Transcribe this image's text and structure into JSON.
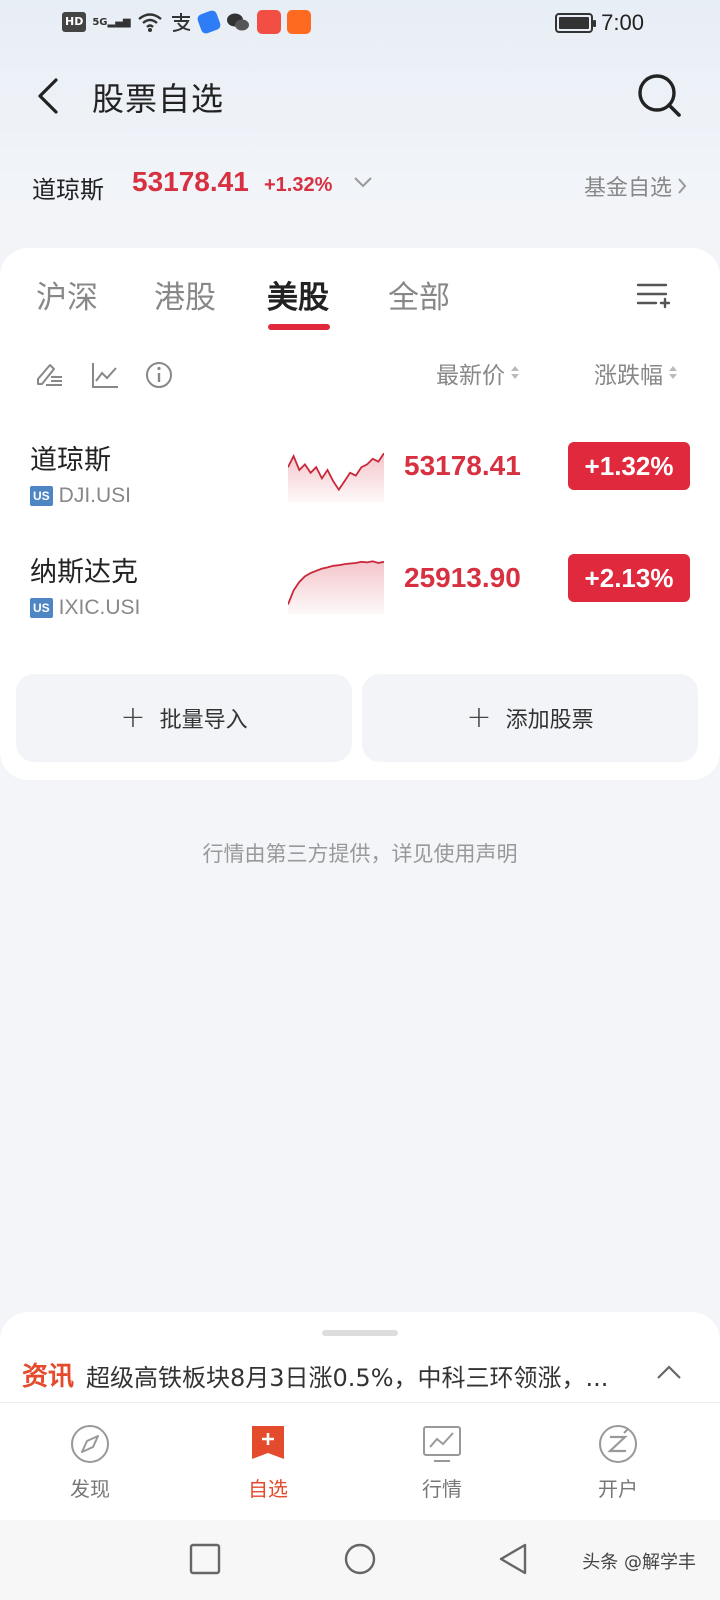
{
  "status_bar": {
    "hd": "HD",
    "signal": "5G",
    "time": "7:00"
  },
  "header": {
    "title": "股票自选"
  },
  "index_summary": {
    "name": "道琼斯",
    "price": "53178.41",
    "change": "+1.32%",
    "fund_link": "基金自选"
  },
  "tabs": [
    {
      "label": "沪深",
      "active": false
    },
    {
      "label": "港股",
      "active": false
    },
    {
      "label": "美股",
      "active": true
    },
    {
      "label": "全部",
      "active": false
    }
  ],
  "columns": {
    "price": "最新价",
    "change": "涨跌幅"
  },
  "stocks": [
    {
      "name": "道琼斯",
      "market": "US",
      "code": "DJI.USI",
      "price": "53178.41",
      "change": "+1.32%",
      "spark": [
        0.55,
        0.75,
        0.5,
        0.6,
        0.45,
        0.55,
        0.35,
        0.5,
        0.3,
        0.15,
        0.3,
        0.45,
        0.4,
        0.55,
        0.6,
        0.7,
        0.65,
        0.8
      ]
    },
    {
      "name": "纳斯达克",
      "market": "US",
      "code": "IXIC.USI",
      "price": "25913.90",
      "change": "+2.13%",
      "spark": [
        0.1,
        0.35,
        0.5,
        0.6,
        0.66,
        0.7,
        0.74,
        0.76,
        0.79,
        0.8,
        0.82,
        0.83,
        0.84,
        0.86,
        0.85,
        0.87,
        0.84,
        0.86
      ]
    }
  ],
  "actions": {
    "batch_import": "批量导入",
    "add_stock": "添加股票"
  },
  "disclaimer": "行情由第三方提供，详见使用声明",
  "news": {
    "tag": "资讯",
    "text": "超级高铁板块8月3日涨0.5%，中科三环领涨，..."
  },
  "bottom_nav": [
    {
      "label": "发现",
      "icon": "compass-icon"
    },
    {
      "label": "自选",
      "icon": "watchlist-plus-icon"
    },
    {
      "label": "行情",
      "icon": "market-chart-icon"
    },
    {
      "label": "开户",
      "icon": "open-account-icon"
    }
  ],
  "watermark": "头条 @解学丰",
  "colors": {
    "up_red": "#d73040",
    "accent": "#e0293c",
    "news_orange": "#e44a2c"
  }
}
